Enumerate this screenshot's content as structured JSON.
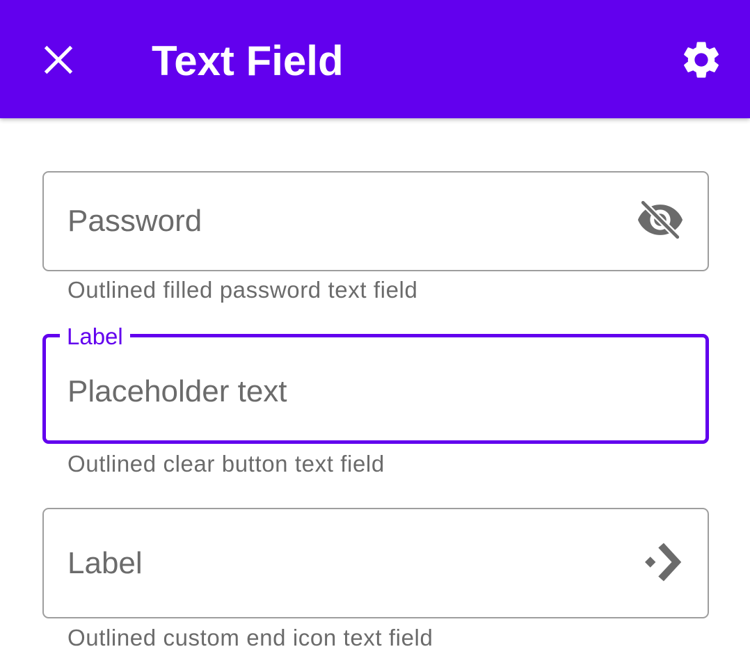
{
  "app_bar": {
    "title": "Text Field",
    "background_color": "#6200ee",
    "close_icon": "close-icon",
    "settings_icon": "gear-icon"
  },
  "fields": [
    {
      "kind": "outlined-password",
      "input_text": "Password",
      "end_icon": "visibility-off-icon",
      "helper_text": "Outlined filled password text field"
    },
    {
      "kind": "outlined-clear",
      "label": "Label",
      "placeholder": "Placeholder text",
      "focused": true,
      "helper_text": "Outlined clear button text field"
    },
    {
      "kind": "outlined-custom-end-icon",
      "input_text": "Label",
      "end_icon": "custom-arrow-icon",
      "helper_text": "Outlined custom end icon text field"
    }
  ],
  "colors": {
    "accent": "#6200ee",
    "outline": "#9e9e9e",
    "text_secondary": "#6b6b6b"
  }
}
